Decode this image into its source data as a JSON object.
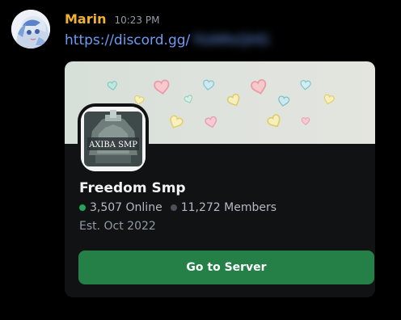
{
  "message": {
    "username": "Marin",
    "timestamp": "10:23 PM",
    "link_text": "https://discord.gg/",
    "link_code_blurred": "YkAMxQHG"
  },
  "invite": {
    "server_name": "Freedom Smp",
    "online": "3,507 Online",
    "members": "11,272 Members",
    "established": "Est. Oct 2022",
    "button_label": "Go to Server",
    "icon_text": "AXIBA SMP"
  },
  "colors": {
    "username": "#f0b232",
    "link": "#6d9cf5",
    "online_dot": "#23a55a",
    "button": "#248046"
  },
  "icons": [
    "user-avatar",
    "server-icon",
    "online-status-dot",
    "members-status-dot"
  ]
}
